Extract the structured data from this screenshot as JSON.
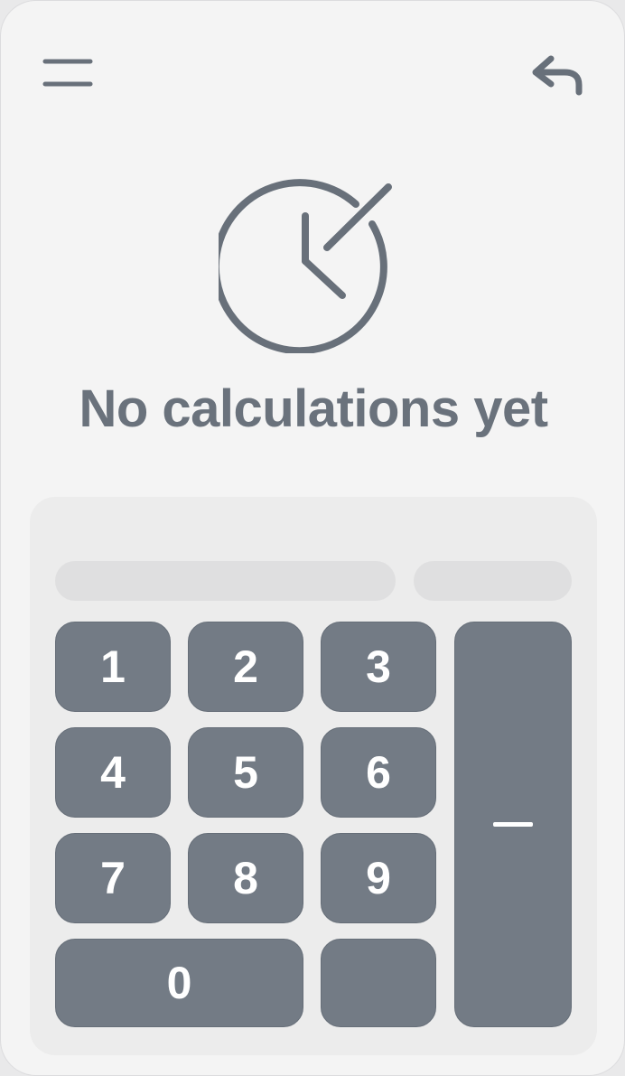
{
  "header": {
    "menu_icon": "hamburger-menu-icon",
    "undo_icon": "undo-arrow-icon"
  },
  "empty_state": {
    "icon": "history-clock-icon",
    "message": "No calculations yet"
  },
  "keypad": {
    "keys": {
      "k1": "1",
      "k2": "2",
      "k3": "3",
      "k4": "4",
      "k5": "5",
      "k6": "6",
      "k7": "7",
      "k8": "8",
      "k9": "9",
      "k0": "0",
      "blank": "",
      "minus_icon": "minus-icon"
    }
  },
  "colors": {
    "background": "#f4f4f4",
    "panel": "#ececec",
    "key": "#737b85",
    "icon": "#6a727c"
  }
}
